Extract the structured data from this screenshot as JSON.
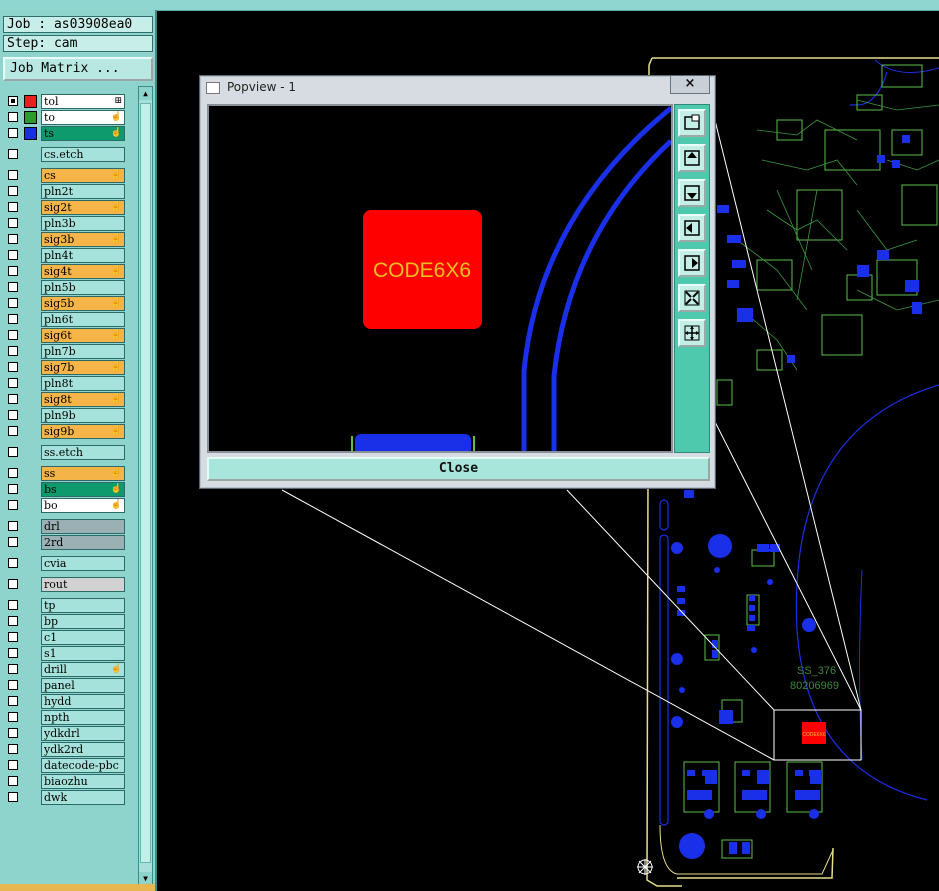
{
  "job_label": "Job : as03908ea0",
  "step_label": "Step: cam",
  "job_matrix_button": "Job Matrix ...",
  "layers": [
    {
      "name": "tol",
      "bg": "#ffffff",
      "swatch": "#e82020",
      "checked": true,
      "affect": "⊞"
    },
    {
      "name": "to",
      "bg": "#ffffff",
      "swatch": "#2e9b2e",
      "checked": false,
      "affect": "☝"
    },
    {
      "name": "ts",
      "bg": "#0f9a6e",
      "swatch": "#1830e0",
      "checked": false,
      "affect": "☝"
    },
    {
      "name": "cs.etch",
      "bg": "#a6e2dc",
      "checked": false,
      "affect": ""
    },
    {
      "name": "cs",
      "bg": "#f5b448",
      "checked": false,
      "affect": "☝"
    },
    {
      "name": "pln2t",
      "bg": "#a6e2dc",
      "checked": false,
      "affect": ""
    },
    {
      "name": "sig2t",
      "bg": "#f5b448",
      "checked": false,
      "affect": "☝"
    },
    {
      "name": "pln3b",
      "bg": "#a6e2dc",
      "checked": false,
      "affect": ""
    },
    {
      "name": "sig3b",
      "bg": "#f5b448",
      "checked": false,
      "affect": "☝"
    },
    {
      "name": "pln4t",
      "bg": "#a6e2dc",
      "checked": false,
      "affect": ""
    },
    {
      "name": "sig4t",
      "bg": "#f5b448",
      "checked": false,
      "affect": "☝"
    },
    {
      "name": "pln5b",
      "bg": "#a6e2dc",
      "checked": false,
      "affect": ""
    },
    {
      "name": "sig5b",
      "bg": "#f5b448",
      "checked": false,
      "affect": "☝"
    },
    {
      "name": "pln6t",
      "bg": "#a6e2dc",
      "checked": false,
      "affect": ""
    },
    {
      "name": "sig6t",
      "bg": "#f5b448",
      "checked": false,
      "affect": "☝"
    },
    {
      "name": "pln7b",
      "bg": "#a6e2dc",
      "checked": false,
      "affect": ""
    },
    {
      "name": "sig7b",
      "bg": "#f5b448",
      "checked": false,
      "affect": "☝"
    },
    {
      "name": "pln8t",
      "bg": "#a6e2dc",
      "checked": false,
      "affect": ""
    },
    {
      "name": "sig8t",
      "bg": "#f5b448",
      "checked": false,
      "affect": "☝"
    },
    {
      "name": "pln9b",
      "bg": "#a6e2dc",
      "checked": false,
      "affect": ""
    },
    {
      "name": "sig9b",
      "bg": "#f5b448",
      "checked": false,
      "affect": "☝"
    },
    {
      "name": "ss.etch",
      "bg": "#a6e2dc",
      "checked": false,
      "affect": ""
    },
    {
      "name": "ss",
      "bg": "#f5b448",
      "checked": false,
      "affect": "☝"
    },
    {
      "name": "bs",
      "bg": "#0f9a6e",
      "checked": false,
      "affect": "☝"
    },
    {
      "name": "bo",
      "bg": "#ffffff",
      "checked": false,
      "affect": "☝"
    },
    {
      "name": "drl",
      "bg": "#9ab0b4",
      "checked": false,
      "affect": ""
    },
    {
      "name": "2rd",
      "bg": "#9ab0b4",
      "checked": false,
      "affect": ""
    },
    {
      "name": "cvia",
      "bg": "#a6e2dc",
      "checked": false,
      "affect": ""
    },
    {
      "name": "rout",
      "bg": "#d2d2d2",
      "checked": false,
      "affect": ""
    },
    {
      "name": "tp",
      "bg": "#a6e2dc",
      "checked": false,
      "affect": ""
    },
    {
      "name": "bp",
      "bg": "#a6e2dc",
      "checked": false,
      "affect": ""
    },
    {
      "name": "c1",
      "bg": "#a6e2dc",
      "checked": false,
      "affect": ""
    },
    {
      "name": "s1",
      "bg": "#a6e2dc",
      "checked": false,
      "affect": ""
    },
    {
      "name": "drill",
      "bg": "#a6e2dc",
      "checked": false,
      "affect": "☝"
    },
    {
      "name": "panel",
      "bg": "#a6e2dc",
      "checked": false,
      "affect": ""
    },
    {
      "name": "hydd",
      "bg": "#a6e2dc",
      "checked": false,
      "affect": ""
    },
    {
      "name": "npth",
      "bg": "#a6e2dc",
      "checked": false,
      "affect": ""
    },
    {
      "name": "ydkdrl",
      "bg": "#a6e2dc",
      "checked": false,
      "affect": ""
    },
    {
      "name": "ydk2rd",
      "bg": "#a6e2dc",
      "checked": false,
      "affect": ""
    },
    {
      "name": "datecode-pbc",
      "bg": "#a6e2dc",
      "checked": false,
      "affect": ""
    },
    {
      "name": "biaozhu",
      "bg": "#a6e2dc",
      "checked": false,
      "affect": ""
    },
    {
      "name": "dwk",
      "bg": "#a6e2dc",
      "checked": false,
      "affect": ""
    }
  ],
  "popview": {
    "title": "Popview - 1",
    "close_x": "×",
    "close_button": "Close",
    "component_label": "CODE6X6",
    "tools": [
      "zoom-window-icon",
      "pan-up-icon",
      "pan-down-icon",
      "pan-left-icon",
      "pan-right-icon",
      "zoom-out-icon",
      "zoom-in-icon"
    ]
  },
  "board": {
    "marking_1": "SS_376",
    "marking_2": "80206969",
    "zoom_label": "CODE6X6"
  },
  "colors": {
    "panel": "#8ed4cd",
    "component_red": "#ff0000",
    "label_yellow": "#e8c020",
    "trace_blue": "#1a2fe8",
    "outline_yellow": "#e8e08a",
    "silk_green": "#5dc04a"
  }
}
